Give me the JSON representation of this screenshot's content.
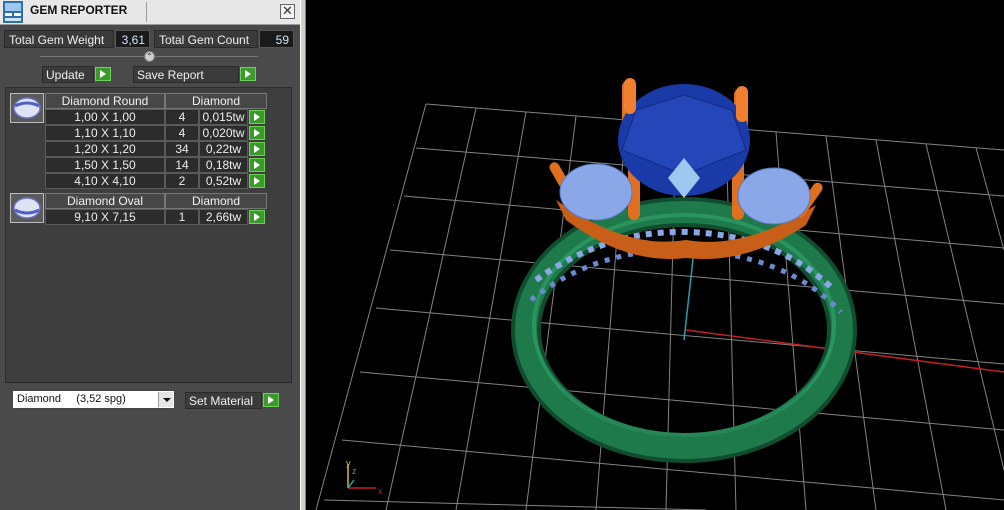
{
  "window": {
    "title": "GEM REPORTER",
    "close_glyph": "✕"
  },
  "stats": {
    "total_weight_label": "Total Gem Weight",
    "total_weight_value": "3,61",
    "total_count_label": "Total Gem Count",
    "total_count_value": "59"
  },
  "toolbar": {
    "update_label": "Update",
    "save_label": "Save Report"
  },
  "groups": [
    {
      "name": "Diamond Round",
      "material": "Diamond",
      "icon": "round-gem-icon",
      "rows": [
        {
          "size": "1,00 X 1,00",
          "count": "4",
          "weight": "0,015tw"
        },
        {
          "size": "1,10 X 1,10",
          "count": "4",
          "weight": "0,020tw"
        },
        {
          "size": "1,20 X 1,20",
          "count": "34",
          "weight": "0,22tw"
        },
        {
          "size": "1,50 X 1,50",
          "count": "14",
          "weight": "0,18tw"
        },
        {
          "size": "4,10 X 4,10",
          "count": "2",
          "weight": "0,52tw"
        }
      ]
    },
    {
      "name": "Diamond Oval",
      "material": "Diamond",
      "icon": "oval-gem-icon",
      "rows": [
        {
          "size": "9,10 X 7,15",
          "count": "1",
          "weight": "2,66tw"
        }
      ]
    }
  ],
  "material": {
    "selected": "Diamond     (3,52 spg)",
    "set_label": "Set Material"
  },
  "viewport": {
    "axis_labels": {
      "x": "x",
      "y": "y",
      "z": "z"
    },
    "colors": {
      "band": "#1e7a4a",
      "prongs": "#e07020",
      "center_stone": "#1a3aa8",
      "side_stones": "#8aa8e8",
      "grid": "#bdbdbd",
      "axis_x": "#c02020",
      "axis_y": "#20a0b0"
    }
  }
}
